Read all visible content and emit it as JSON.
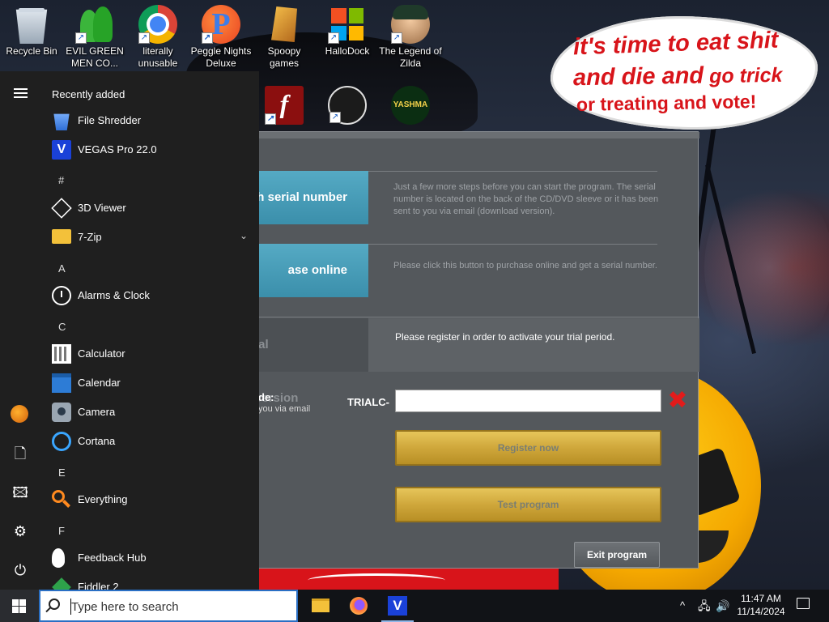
{
  "desktop": {
    "icons": [
      {
        "label": "Recycle Bin"
      },
      {
        "label": "EVIL GREEN MEN CO..."
      },
      {
        "label": "literally unusable"
      },
      {
        "label": "Peggle Nights Deluxe"
      },
      {
        "label": "Spoopy games"
      },
      {
        "label": "HalloDock"
      },
      {
        "label": "The Legend of Zilda"
      }
    ],
    "row2_yashma_text": "YASHMA",
    "bubble": {
      "line1": "it's time to eat shit",
      "line2a": "and die and",
      "line2b": " go trick",
      "line3": "or treating and vote!"
    }
  },
  "dialog": {
    "serial_button": "h serial number",
    "serial_info": "Just a few more steps before you can start the program. The serial number is located on the back of the CD/DVD sleeve or it has been sent to you via email (download version).",
    "purchase_button": "ase online",
    "purchase_info": "Please click this button to purchase online and get a serial number.",
    "trial_button": "ial version",
    "trial_info": "Please register in order to activate your trial period.",
    "code_label": "de:",
    "code_sub": "you via email",
    "code_prefix": "TRIALC-",
    "code_value": "",
    "register_button": "Register now",
    "test_button": "Test program",
    "exit_button": "Exit program",
    "clear_glyph": "✖"
  },
  "start_menu": {
    "recently_added_header": "Recently added",
    "sections": [
      {
        "letter": "",
        "apps": [
          {
            "label": "File Shredder"
          },
          {
            "label": "VEGAS Pro 22.0"
          }
        ]
      },
      {
        "letter": "#",
        "apps": [
          {
            "label": "3D Viewer"
          },
          {
            "label": "7-Zip"
          }
        ]
      },
      {
        "letter": "A",
        "apps": [
          {
            "label": "Alarms & Clock"
          }
        ]
      },
      {
        "letter": "C",
        "apps": [
          {
            "label": "Calculator"
          },
          {
            "label": "Calendar"
          },
          {
            "label": "Camera"
          },
          {
            "label": "Cortana"
          }
        ]
      },
      {
        "letter": "E",
        "apps": [
          {
            "label": "Everything"
          }
        ]
      },
      {
        "letter": "F",
        "apps": [
          {
            "label": "Feedback Hub"
          },
          {
            "label": "Fiddler 2"
          }
        ]
      }
    ]
  },
  "taskbar": {
    "search_placeholder": "Type here to search",
    "time": "11:47 AM",
    "date": "11/14/2024",
    "tray_chevron": "^"
  }
}
